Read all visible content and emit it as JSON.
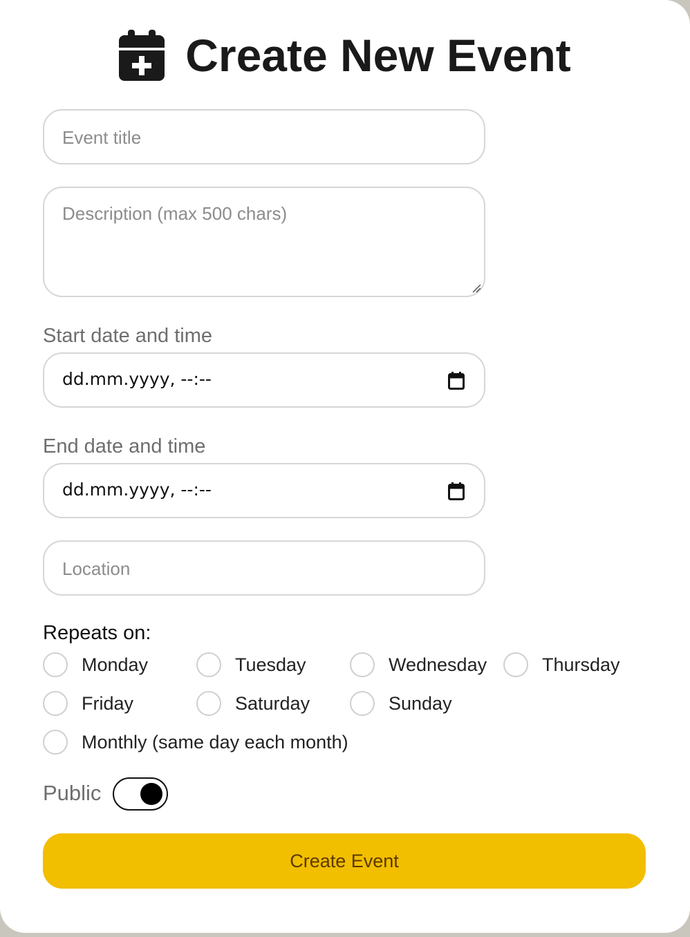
{
  "header": {
    "title": "Create New Event",
    "icon": "calendar-plus-icon"
  },
  "form": {
    "title_placeholder": "Event title",
    "description_placeholder": "Description (max 500 chars)",
    "start_label": "Start date and time",
    "start_value": "dd.mm.yyyy, --:--",
    "end_label": "End date and time",
    "end_value": "dd.mm.yyyy, --:--",
    "location_placeholder": "Location",
    "repeats_label": "Repeats on:",
    "repeat_options": [
      "Monday",
      "Tuesday",
      "Wednesday",
      "Thursday",
      "Friday",
      "Saturday",
      "Sunday",
      "Monthly (same day each month)"
    ],
    "public_label": "Public",
    "public_on": true,
    "submit_label": "Create Event"
  },
  "colors": {
    "accent": "#f2be00",
    "button_text": "#5a3a00",
    "border": "#d6d6d6"
  }
}
